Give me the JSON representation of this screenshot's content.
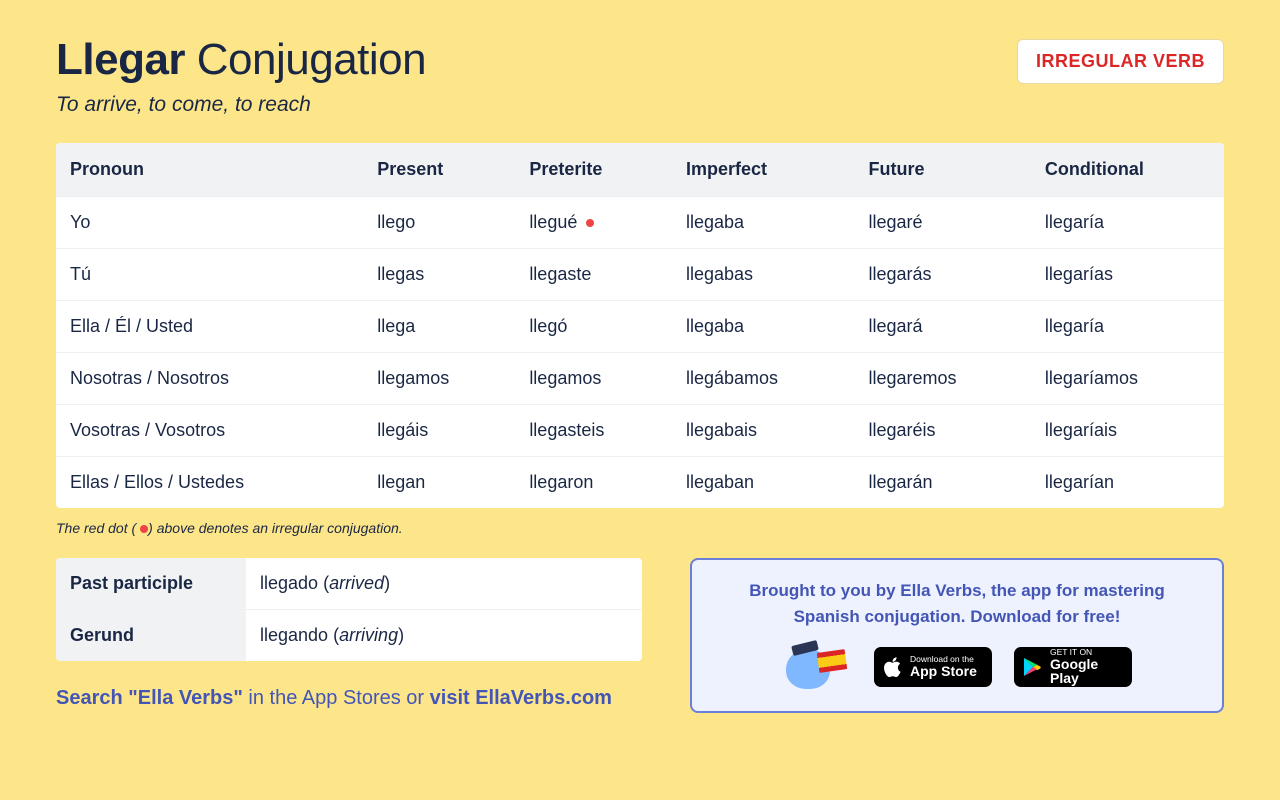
{
  "header": {
    "verb": "Llegar",
    "title_suffix": "Conjugation",
    "subtitle": "To arrive, to come, to reach",
    "badge": "IRREGULAR VERB"
  },
  "table": {
    "headers": [
      "Pronoun",
      "Present",
      "Preterite",
      "Imperfect",
      "Future",
      "Conditional"
    ],
    "rows": [
      {
        "pronoun": "Yo",
        "present": "llego",
        "preterite": "llegué",
        "preterite_irregular": true,
        "imperfect": "llegaba",
        "future": "llegaré",
        "conditional": "llegaría"
      },
      {
        "pronoun": "Tú",
        "present": "llegas",
        "preterite": "llegaste",
        "imperfect": "llegabas",
        "future": "llegarás",
        "conditional": "llegarías"
      },
      {
        "pronoun": "Ella / Él / Usted",
        "present": "llega",
        "preterite": "llegó",
        "imperfect": "llegaba",
        "future": "llegará",
        "conditional": "llegaría"
      },
      {
        "pronoun": "Nosotras / Nosotros",
        "present": "llegamos",
        "preterite": "llegamos",
        "imperfect": "llegábamos",
        "future": "llegaremos",
        "conditional": "llegaríamos"
      },
      {
        "pronoun": "Vosotras / Vosotros",
        "present": "llegáis",
        "preterite": "llegasteis",
        "imperfect": "llegabais",
        "future": "llegaréis",
        "conditional": "llegaríais"
      },
      {
        "pronoun": "Ellas / Ellos / Ustedes",
        "present": "llegan",
        "preterite": "llegaron",
        "imperfect": "llegaban",
        "future": "llegarán",
        "conditional": "llegarían"
      }
    ]
  },
  "footnote": {
    "before": "The red dot (",
    "after": ") above denotes an irregular conjugation."
  },
  "forms": {
    "past_participle_label": "Past participle",
    "past_participle_value": "llegado",
    "past_participle_trans": "arrived",
    "gerund_label": "Gerund",
    "gerund_value": "llegando",
    "gerund_trans": "arriving"
  },
  "search_line": {
    "prefix": "Search \"Ella Verbs\"",
    "middle": " in the App Stores or ",
    "suffix": "visit EllaVerbs.com"
  },
  "promo": {
    "line1": "Brought to you by Ella Verbs, the app for mastering",
    "line2": "Spanish conjugation. Download for free!",
    "appstore_small": "Download on the",
    "appstore_big": "App Store",
    "play_small": "GET IT ON",
    "play_big": "Google Play"
  }
}
